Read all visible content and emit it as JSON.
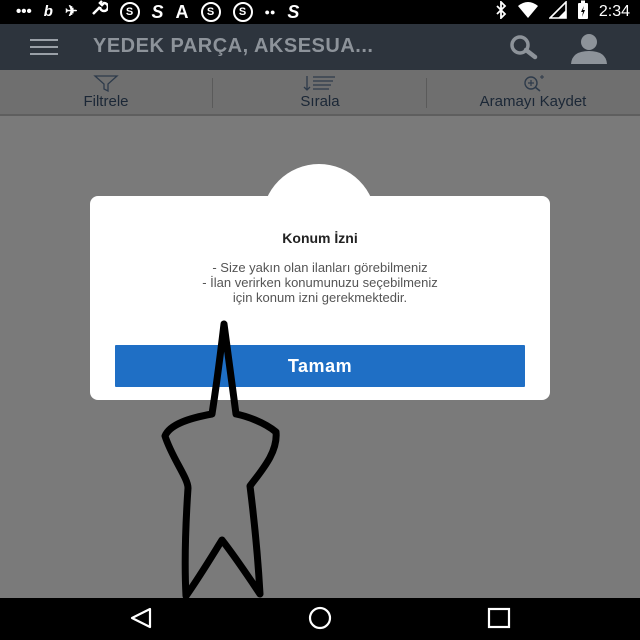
{
  "status_bar": {
    "left_icons": [
      "chat-bubble-icon",
      "b-icon",
      "bird-icon",
      "wrench-icon",
      "badge-icon",
      "s-icon",
      "a-icon",
      "badge-icon",
      "badge-icon",
      "bubble-icon",
      "s-icon"
    ],
    "left_glyphs": [
      "•••",
      "b",
      "✈",
      "🔧",
      "S",
      "S",
      "A",
      "S",
      "S",
      "●●",
      "S"
    ],
    "time": "2:34"
  },
  "app_bar": {
    "title": "YEDEK PARÇA, AKSESUA..."
  },
  "toolbar": {
    "filter_label": "Filtrele",
    "sort_label": "Sırala",
    "save_search_label": "Aramayı Kaydet"
  },
  "dialog": {
    "title": "Konum İzni",
    "lines": [
      "- Size yakın olan ilanları görebilmeniz",
      "- İlan verirken konumunuzu seçebilmeniz",
      "için konum izni gerekmektedir."
    ],
    "button_label": "Tamam"
  },
  "colors": {
    "app_bar": "#2d343d",
    "overlay": "#7a7a7a",
    "button": "#1f6fc5"
  }
}
